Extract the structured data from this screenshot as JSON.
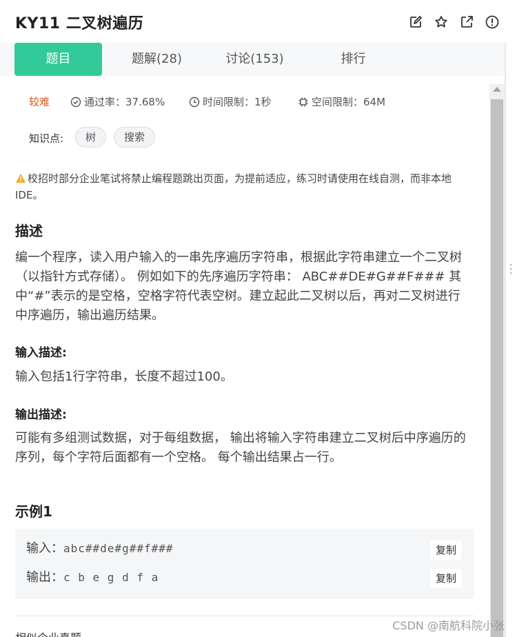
{
  "header": {
    "title": "KY11  二叉树遍历"
  },
  "tabs": [
    {
      "label": "题目"
    },
    {
      "label": "题解(28)"
    },
    {
      "label": "讨论(153)"
    },
    {
      "label": "排行"
    }
  ],
  "meta": {
    "difficulty": "较难",
    "pass_rate": "通过率：37.68%",
    "time_limit": "时间限制：1秒",
    "space_limit": "空间限制：64M"
  },
  "knowledge": {
    "label": "知识点:",
    "tags": [
      "树",
      "搜索"
    ]
  },
  "notice": "校招时部分企业笔试将禁止编程题跳出页面，为提前适应，练习时请使用在线自测，而非本地IDE。",
  "description": {
    "heading": "描述",
    "text": "编一个程序，读入用户输入的一串先序遍历字符串，根据此字符串建立一个二叉树（以指针方式存储）。 例如如下的先序遍历字符串： ABC##DE#G##F### 其中“#”表示的是空格，空格字符代表空树。建立起此二叉树以后，再对二叉树进行中序遍历，输出遍历结果。"
  },
  "input_desc": {
    "heading": "输入描述:",
    "text": "输入包括1行字符串，长度不超过100。"
  },
  "output_desc": {
    "heading": "输出描述:",
    "text": "可能有多组测试数据，对于每组数据， 输出将输入字符串建立二叉树后中序遍历的序列，每个字符后面都有一个空格。 每个输出结果占一行。"
  },
  "example": {
    "heading": "示例1",
    "input_label": "输入：",
    "input_value": "abc##de#g##f###",
    "output_label": "输出：",
    "output_value": "c b e g d f a",
    "copy_label": "复制"
  },
  "related": "相似企业真题",
  "watermark": "CSDN @南航科院小张",
  "colors": {
    "accent": "#32ca99",
    "difficulty": "#d9551b",
    "warning": "#f5a623"
  },
  "icons": [
    "edit-icon",
    "star-icon",
    "external-link-icon",
    "info-icon",
    "check-circle-icon",
    "clock-icon",
    "chip-icon",
    "warning-icon"
  ]
}
